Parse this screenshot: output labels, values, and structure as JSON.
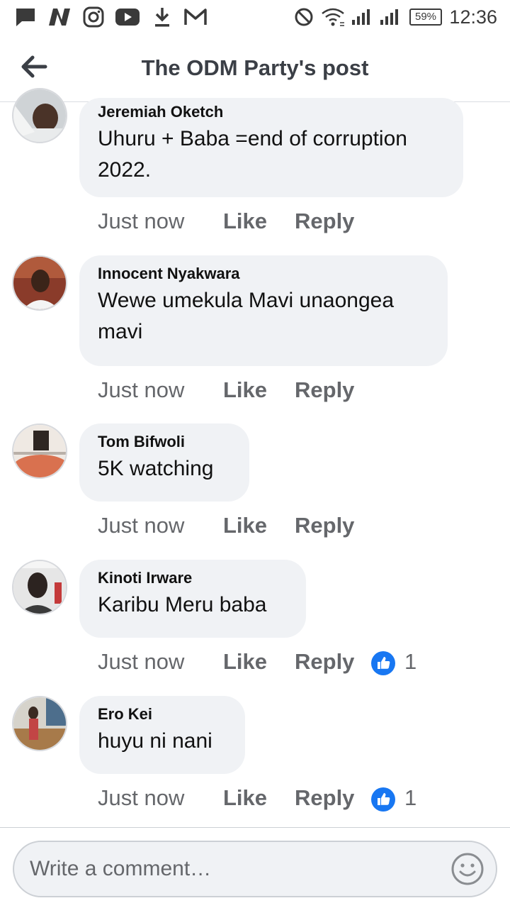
{
  "status_bar": {
    "time": "12:36",
    "battery": "59%",
    "left_icons": [
      "chat-icon",
      "news-icon",
      "instagram-icon",
      "youtube-icon",
      "download-icon",
      "gmail-icon"
    ],
    "right_icons": [
      "do-not-disturb-icon",
      "wifi-icon",
      "signal-icon",
      "signal-icon"
    ]
  },
  "header": {
    "title": "The ODM Party's post",
    "back_icon": "back-arrow-icon"
  },
  "comments": [
    {
      "author": "Jeremiah Oketch",
      "text": "Uhuru + Baba =end of corruption 2022.",
      "time": "Just now",
      "like": "Like",
      "reply": "Reply",
      "reactions": ""
    },
    {
      "author": "Innocent Nyakwara",
      "text": "Wewe umekula Mavi unaongea mavi",
      "time": "Just now",
      "like": "Like",
      "reply": "Reply",
      "reactions": ""
    },
    {
      "author": "Tom Bifwoli",
      "text": "5K watching",
      "time": "Just now",
      "like": "Like",
      "reply": "Reply",
      "reactions": ""
    },
    {
      "author": "Kinoti Irware",
      "text": "Karibu Meru baba",
      "time": "Just now",
      "like": "Like",
      "reply": "Reply",
      "reactions": "1"
    },
    {
      "author": "Ero Kei",
      "text": "huyu ni nani",
      "time": "Just now",
      "like": "Like",
      "reply": "Reply",
      "reactions": "1"
    }
  ],
  "composer": {
    "placeholder": "Write a comment…",
    "emoji_icon": "emoji-icon"
  },
  "colors": {
    "bubble": "#f0f2f5",
    "action_text": "#65676b",
    "like_reaction": "#1877f2"
  }
}
